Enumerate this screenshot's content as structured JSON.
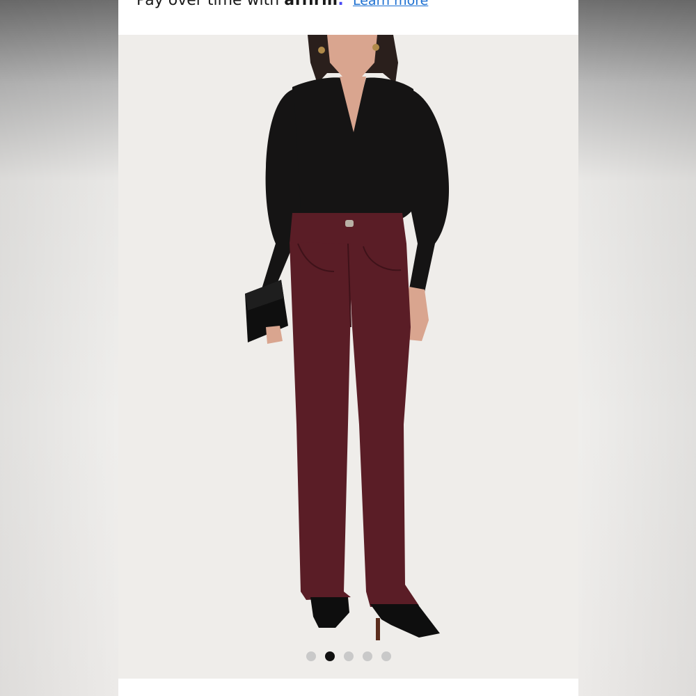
{
  "affirm_banner": {
    "text": "Pay over time with ",
    "brand": "affirm",
    "period": ".",
    "learn_more": "Learn more"
  },
  "product_image": {
    "subject": "model wearing black wrap blouse and burgundy flare jeans with black clutch and black heeled boots",
    "colors": {
      "background": "#efedea",
      "top": "#151414",
      "jeans": "#5a1d26",
      "skin": "#d9a58f",
      "hair": "#2a1f1c"
    }
  },
  "carousel": {
    "total": 5,
    "active_index": 1
  }
}
